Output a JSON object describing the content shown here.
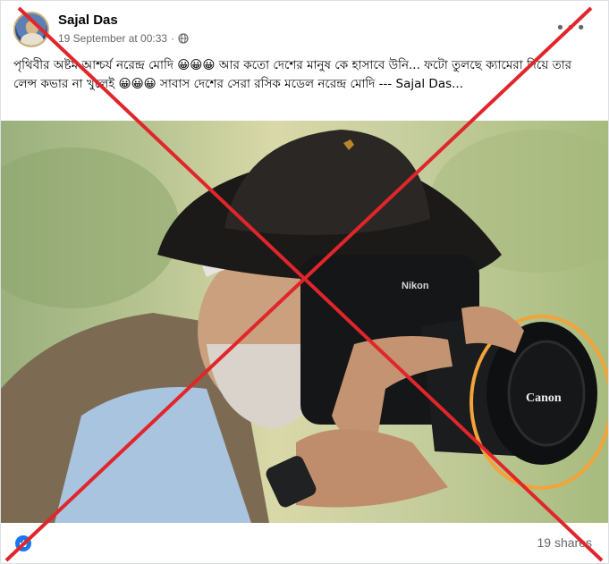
{
  "post": {
    "author": "Sajal Das",
    "timestamp": "19 September at 00:33",
    "separator": "·",
    "privacy_icon": "globe-icon",
    "more_icon": "more-horizontal-icon",
    "caption": "পৃথিবীর অষ্টম আশ্চর্য নরেন্দ্র মোদি 😀😀😀 আর কতো দেশের মানুষ কে হাসাবে উনি... ফটো তুলছে ক্যামেরা দিয়ে তার লেন্স কভার না খুলেই 😀😀😀 সাবাস দেশের সেরা রসিক মডেল নরেন্দ্র মোদি --- Sajal Das...",
    "see_more": ""
  },
  "photo": {
    "camera_brand": "Nikon",
    "lens_cap_brand": "Canon"
  },
  "footer": {
    "reaction_icon": "like-icon",
    "shares": "19 shares"
  },
  "colors": {
    "cross_red": "#e0262b",
    "highlight_orange": "#f2a33a",
    "facebook_blue": "#1877f2"
  }
}
